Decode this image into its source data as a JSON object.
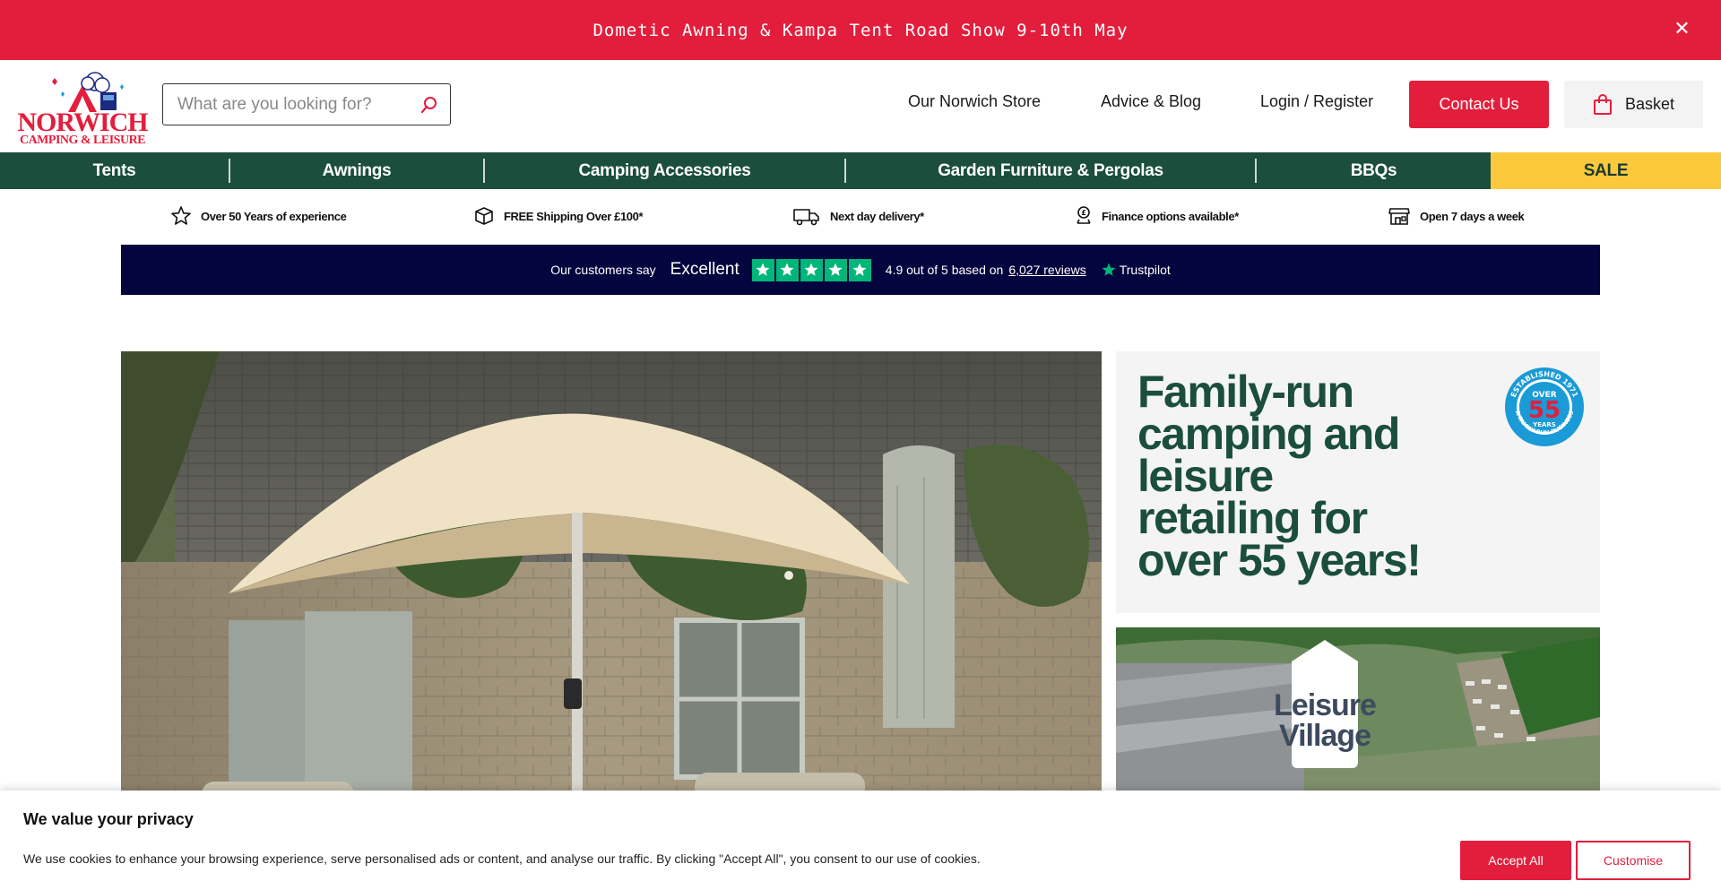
{
  "announcement": {
    "text": "Dometic Awning & Kampa Tent Road Show 9-10th May",
    "close_icon": "close-icon"
  },
  "header": {
    "logo_line1": "NORWICH",
    "logo_line2": "CAMPING & LEISURE",
    "search_placeholder": "What are you looking for?",
    "links": {
      "store": "Our Norwich Store",
      "blog": "Advice & Blog",
      "login": "Login / Register"
    },
    "contact_label": "Contact Us",
    "basket_label": "Basket"
  },
  "categories": [
    {
      "label": "Tents"
    },
    {
      "label": "Awnings"
    },
    {
      "label": "Camping Accessories"
    },
    {
      "label": "Garden Furniture & Pergolas"
    },
    {
      "label": "BBQs"
    },
    {
      "label": "SALE"
    }
  ],
  "usp": [
    {
      "icon": "star-outline-icon",
      "label": "Over 50 Years of experience"
    },
    {
      "icon": "box-icon",
      "label": "FREE Shipping Over £100*"
    },
    {
      "icon": "truck-icon",
      "label": "Next day delivery*"
    },
    {
      "icon": "finance-icon",
      "label": "Finance options available*"
    },
    {
      "icon": "store-icon",
      "label": "Open 7 days a week"
    }
  ],
  "trustpilot": {
    "say": "Our customers say",
    "rating_word": "Excellent",
    "score_text": "4.9 out of 5 based on",
    "reviews_link": "6,027 reviews",
    "brand": "Trustpilot",
    "stars": 5
  },
  "promo": {
    "heading": "Family-run camping and leisure retailing for over 55 years!",
    "badge_top": "ESTABLISHED 1971",
    "badge_over": "OVER",
    "badge_number": "55",
    "badge_years": "YEARS",
    "badge_bottom": "A FAMILY-RUN BUSINESS"
  },
  "village": {
    "line1": "Leisure",
    "line2": "Village"
  },
  "cookie": {
    "title": "We value your privacy",
    "text": "We use cookies to enhance your browsing experience, serve personalised ads or content, and analyse our traffic. By clicking \"Accept All\", you consent to our use of cookies.",
    "accept": "Accept All",
    "customise": "Customise"
  },
  "colors": {
    "brand_red": "#e31e3c",
    "brand_green": "#1b4e3c",
    "sale_yellow": "#fdc93c",
    "trust_navy": "#04043e",
    "trust_green": "#00b67a"
  }
}
